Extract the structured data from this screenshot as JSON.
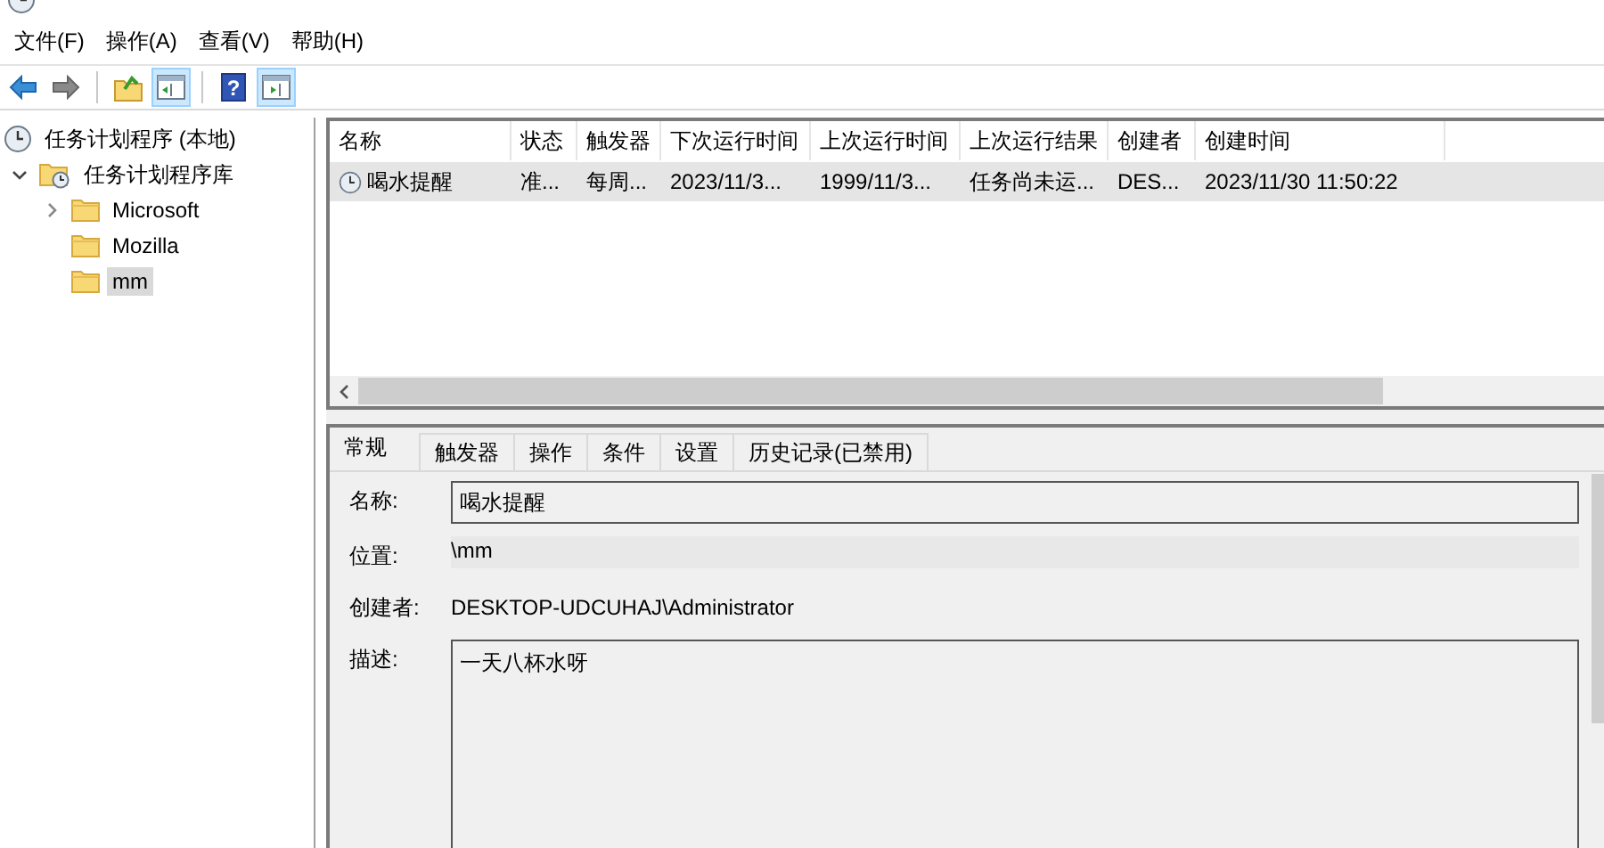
{
  "menu": [
    {
      "label": "文件(F)"
    },
    {
      "label": "操作(A)"
    },
    {
      "label": "查看(V)"
    },
    {
      "label": "帮助(H)"
    }
  ],
  "toolbar": [
    {
      "kind": "back",
      "pressed": false
    },
    {
      "kind": "forward",
      "pressed": false
    },
    {
      "kind": "sep"
    },
    {
      "kind": "up",
      "pressed": false
    },
    {
      "kind": "tree-pane",
      "pressed": true
    },
    {
      "kind": "sep"
    },
    {
      "kind": "help",
      "glyph": "?",
      "pressed": false
    },
    {
      "kind": "action-pane",
      "pressed": true
    }
  ],
  "tree": [
    {
      "label": "任务计划程序 (本地)",
      "kind": "root",
      "selected": false,
      "children": [
        {
          "label": "任务计划程序库",
          "kind": "library",
          "selected": false,
          "expanded": true,
          "children": [
            {
              "label": "Microsoft",
              "kind": "folder",
              "selected": false,
              "expanded": false
            },
            {
              "label": "Mozilla",
              "kind": "folder",
              "selected": false
            },
            {
              "label": "mm",
              "kind": "folder",
              "selected": true
            }
          ]
        }
      ]
    }
  ],
  "table": {
    "columns": [
      "名称",
      "状态",
      "触发器",
      "下次运行时间",
      "上次运行时间",
      "上次运行结果",
      "创建者",
      "创建时间"
    ],
    "rows": [
      {
        "selected": true,
        "cells": [
          "喝水提醒",
          "准...",
          "每周...",
          "2023/11/3...",
          "1999/11/3...",
          "任务尚未运...",
          "DES...",
          "2023/11/30 11:50:22"
        ]
      }
    ]
  },
  "tabs": [
    {
      "label": "常规",
      "selected": true
    },
    {
      "label": "触发器",
      "selected": false
    },
    {
      "label": "操作",
      "selected": false
    },
    {
      "label": "条件",
      "selected": false
    },
    {
      "label": "设置",
      "selected": false
    },
    {
      "label": "历史记录(已禁用)",
      "selected": false
    }
  ],
  "fields": [
    {
      "label": "名称:",
      "value": "喝水提醒",
      "kind": "box"
    },
    {
      "label": "位置:",
      "value": "\\mm",
      "kind": "shaded"
    },
    {
      "label": "创建者:",
      "value": "DESKTOP-UDCUHAJ\\Administrator",
      "kind": "plain"
    },
    {
      "label": "描述:",
      "value": "一天八杯水呀",
      "kind": "area"
    }
  ]
}
